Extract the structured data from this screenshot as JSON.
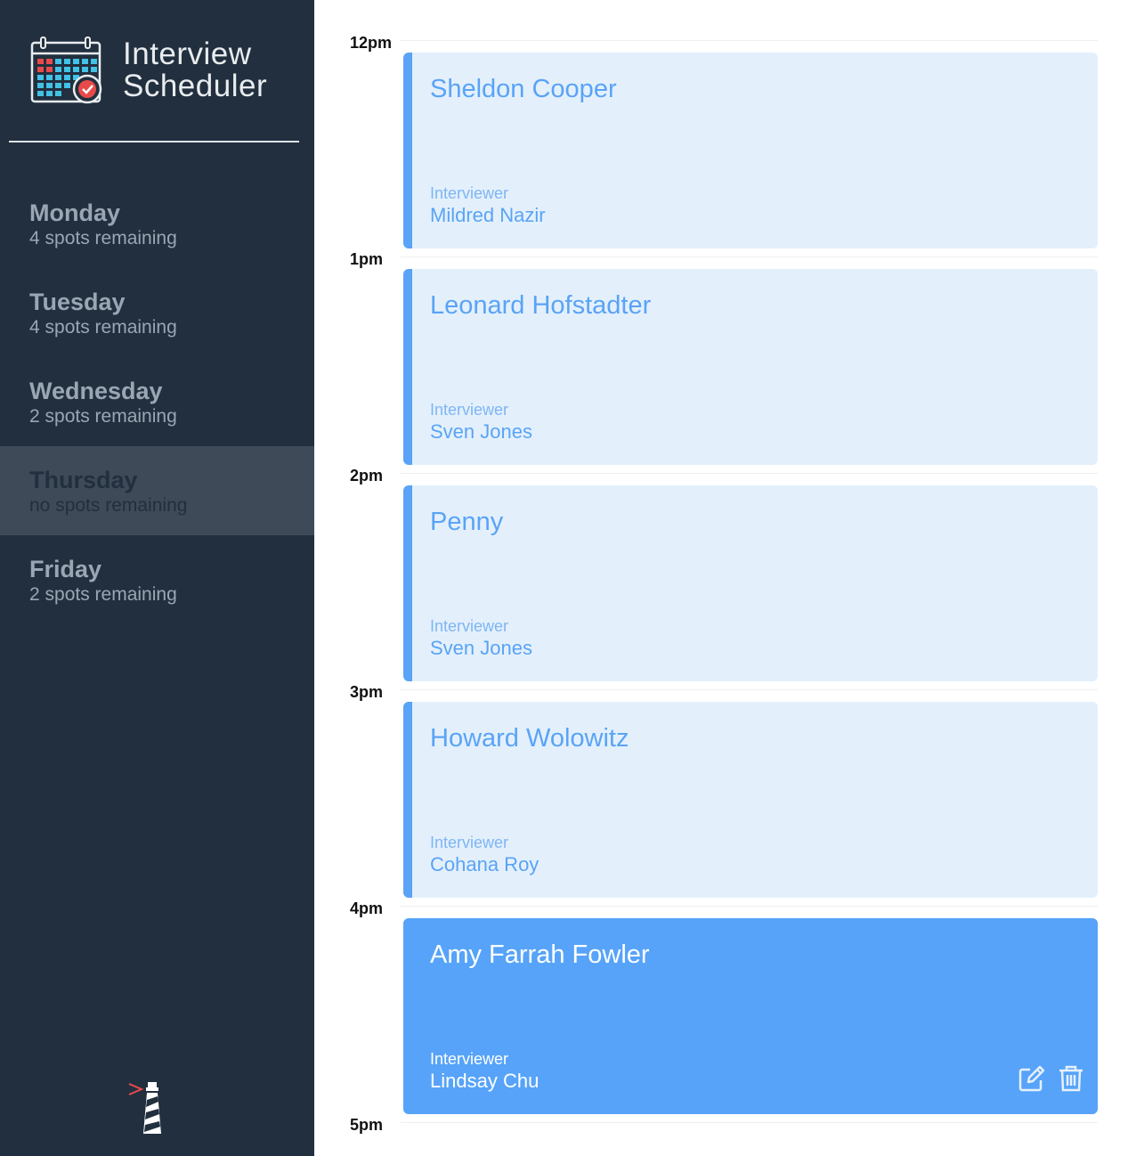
{
  "app": {
    "title_line1": "Interview",
    "title_line2": "Scheduler"
  },
  "days": [
    {
      "name": "Monday",
      "spots": "4 spots remaining",
      "selected": false
    },
    {
      "name": "Tuesday",
      "spots": "4 spots remaining",
      "selected": false
    },
    {
      "name": "Wednesday",
      "spots": "2 spots remaining",
      "selected": false
    },
    {
      "name": "Thursday",
      "spots": "no spots remaining",
      "selected": true
    },
    {
      "name": "Friday",
      "spots": "2 spots remaining",
      "selected": false
    }
  ],
  "appointments": [
    {
      "time": "12pm",
      "student": "Sheldon Cooper",
      "interviewer_label": "Interviewer",
      "interviewer": "Mildred Nazir",
      "active": false
    },
    {
      "time": "1pm",
      "student": "Leonard Hofstadter",
      "interviewer_label": "Interviewer",
      "interviewer": "Sven Jones",
      "active": false
    },
    {
      "time": "2pm",
      "student": "Penny",
      "interviewer_label": "Interviewer",
      "interviewer": "Sven Jones",
      "active": false
    },
    {
      "time": "3pm",
      "student": "Howard Wolowitz",
      "interviewer_label": "Interviewer",
      "interviewer": "Cohana Roy",
      "active": false
    },
    {
      "time": "4pm",
      "student": "Amy Farrah Fowler",
      "interviewer_label": "Interviewer",
      "interviewer": "Lindsay Chu",
      "active": true
    }
  ],
  "end_time": "5pm",
  "icons": {
    "logo": "calendar-check-icon",
    "footer": "lighthouse-icon",
    "edit": "edit-icon",
    "delete": "trash-icon"
  },
  "colors": {
    "sidebar": "#222f3e",
    "selected_day": "#3e4a57",
    "accent": "#5aa3f6",
    "card_bg": "#e3f0fc"
  }
}
